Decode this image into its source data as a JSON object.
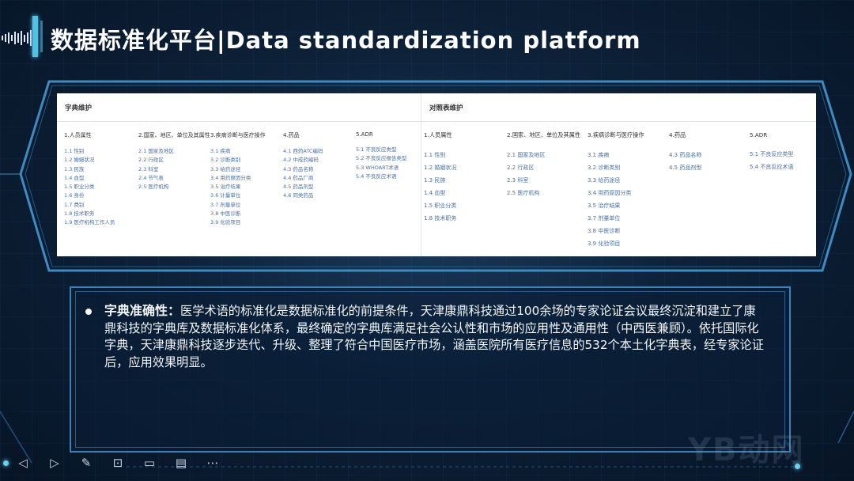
{
  "header": {
    "title": "数据标准化平台|Data standardization platform"
  },
  "dictionary_panel": {
    "title": "字典维护",
    "columns": [
      {
        "heading": "1.人员属性",
        "items": [
          "1.1 性别",
          "1.2 婚姻状况",
          "1.3 民族",
          "1.4 血型",
          "1.5 职业分类",
          "1.6 身份",
          "1.7 费别",
          "1.8 技术职务",
          "1.9 医疗机构工作人员"
        ]
      },
      {
        "heading": "2.国家、地区、单位及其属性",
        "items": [
          "2.1 国家及地区",
          "2.2 行政区",
          "2.3 科室",
          "2.4 节气表",
          "2.5 医疗机构"
        ]
      },
      {
        "heading": "3.疾病诊断与医疗操作",
        "items": [
          "3.1 疾病",
          "3.2 诊断类别",
          "3.3 给药途径",
          "3.4 用药原因分类",
          "3.5 治疗结果",
          "3.6 计量单位",
          "3.7 剂量单位",
          "3.8 中医诊断",
          "3.9 化验项目"
        ]
      },
      {
        "heading": "4.药品",
        "items": [
          "4.1 西药ATC编码",
          "4.2 中成药编码",
          "4.3 药品名称",
          "4.4 药品厂商",
          "4.5 药品剂型",
          "4.6 同类药品"
        ]
      },
      {
        "heading": "5.ADR",
        "items": [
          "5.1 不良反应类型",
          "5.2 不良反应报告类型",
          "5.3 WHOART术语",
          "5.4 不良反应术语"
        ]
      }
    ]
  },
  "mapping_panel": {
    "title": "对照表维护",
    "columns": [
      {
        "heading": "1.人员属性",
        "items": [
          "1.1 性别",
          "1.2 婚姻状况",
          "1.3 民族",
          "1.4 血型",
          "1.5 职业分类",
          "1.8 技术职务"
        ]
      },
      {
        "heading": "2.国家、地区、单位及其属性",
        "items": [
          "2.1 国家及地区",
          "2.2 行政区",
          "2.3 科室",
          "2.5 医疗机构"
        ]
      },
      {
        "heading": "3.疾病诊断与医疗操作",
        "items": [
          "3.1 疾病",
          "3.2 诊断类别",
          "3.3 给药途径",
          "3.4 用药原因分类",
          "3.5 治疗结果",
          "3.7 剂量单位",
          "3.8 中医诊断",
          "3.9 化验项目"
        ]
      },
      {
        "heading": "4.药品",
        "items": [
          "4.3 药品名称",
          "4.5 药品剂型"
        ]
      },
      {
        "heading": "5.ADR",
        "items": [
          "5.1 不良反应类型",
          "5.4 不良反应术语"
        ]
      }
    ]
  },
  "description": {
    "lead": "字典准确性：",
    "body": "医学术语的标准化是数据标准化的前提条件，天津康鼎科技通过100余场的专家论证会议最终沉淀和建立了康鼎科技的字典库及数据标准化体系，最终确定的字典库满足社会公认性和市场的应用性及通用性（中西医兼顾）。依托国际化字典，天津康鼎科技逐步迭代、升级、整理了符合中国医疗市场，涵盖医院所有医疗信息的532个本土化字典表，经专家论证后，应用效果明显。"
  },
  "toolbar": {
    "buttons": [
      {
        "name": "prev-icon",
        "glyph": "◁"
      },
      {
        "name": "next-icon",
        "glyph": "▷"
      },
      {
        "name": "pen-icon",
        "glyph": "✎"
      },
      {
        "name": "select-icon",
        "glyph": "⊡"
      },
      {
        "name": "camera-icon",
        "glyph": "▭"
      },
      {
        "name": "comment-icon",
        "glyph": "▤"
      },
      {
        "name": "more-icon",
        "glyph": "⋯"
      }
    ]
  },
  "watermark": {
    "text": "YB动网"
  },
  "colors": {
    "accent": "#4fc3e6",
    "frame": "#3e7fb4",
    "link": "#4a6fa5"
  }
}
